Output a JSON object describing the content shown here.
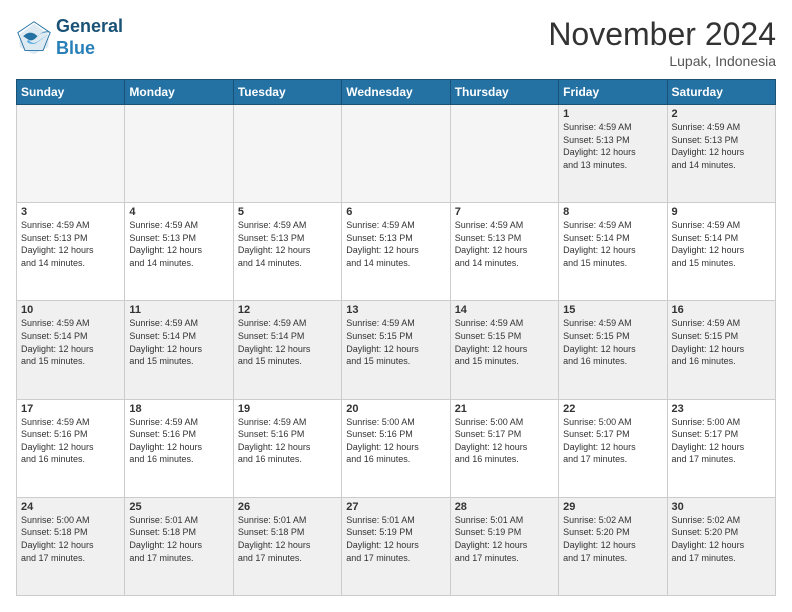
{
  "logo": {
    "line1": "General",
    "line2": "Blue"
  },
  "header": {
    "month": "November 2024",
    "location": "Lupak, Indonesia"
  },
  "weekdays": [
    "Sunday",
    "Monday",
    "Tuesday",
    "Wednesday",
    "Thursday",
    "Friday",
    "Saturday"
  ],
  "weeks": [
    [
      {
        "day": "",
        "info": "",
        "empty": true
      },
      {
        "day": "",
        "info": "",
        "empty": true
      },
      {
        "day": "",
        "info": "",
        "empty": true
      },
      {
        "day": "",
        "info": "",
        "empty": true
      },
      {
        "day": "",
        "info": "",
        "empty": true
      },
      {
        "day": "1",
        "info": "Sunrise: 4:59 AM\nSunset: 5:13 PM\nDaylight: 12 hours\nand 13 minutes.",
        "empty": false
      },
      {
        "day": "2",
        "info": "Sunrise: 4:59 AM\nSunset: 5:13 PM\nDaylight: 12 hours\nand 14 minutes.",
        "empty": false
      }
    ],
    [
      {
        "day": "3",
        "info": "Sunrise: 4:59 AM\nSunset: 5:13 PM\nDaylight: 12 hours\nand 14 minutes.",
        "empty": false
      },
      {
        "day": "4",
        "info": "Sunrise: 4:59 AM\nSunset: 5:13 PM\nDaylight: 12 hours\nand 14 minutes.",
        "empty": false
      },
      {
        "day": "5",
        "info": "Sunrise: 4:59 AM\nSunset: 5:13 PM\nDaylight: 12 hours\nand 14 minutes.",
        "empty": false
      },
      {
        "day": "6",
        "info": "Sunrise: 4:59 AM\nSunset: 5:13 PM\nDaylight: 12 hours\nand 14 minutes.",
        "empty": false
      },
      {
        "day": "7",
        "info": "Sunrise: 4:59 AM\nSunset: 5:13 PM\nDaylight: 12 hours\nand 14 minutes.",
        "empty": false
      },
      {
        "day": "8",
        "info": "Sunrise: 4:59 AM\nSunset: 5:14 PM\nDaylight: 12 hours\nand 15 minutes.",
        "empty": false
      },
      {
        "day": "9",
        "info": "Sunrise: 4:59 AM\nSunset: 5:14 PM\nDaylight: 12 hours\nand 15 minutes.",
        "empty": false
      }
    ],
    [
      {
        "day": "10",
        "info": "Sunrise: 4:59 AM\nSunset: 5:14 PM\nDaylight: 12 hours\nand 15 minutes.",
        "empty": false
      },
      {
        "day": "11",
        "info": "Sunrise: 4:59 AM\nSunset: 5:14 PM\nDaylight: 12 hours\nand 15 minutes.",
        "empty": false
      },
      {
        "day": "12",
        "info": "Sunrise: 4:59 AM\nSunset: 5:14 PM\nDaylight: 12 hours\nand 15 minutes.",
        "empty": false
      },
      {
        "day": "13",
        "info": "Sunrise: 4:59 AM\nSunset: 5:15 PM\nDaylight: 12 hours\nand 15 minutes.",
        "empty": false
      },
      {
        "day": "14",
        "info": "Sunrise: 4:59 AM\nSunset: 5:15 PM\nDaylight: 12 hours\nand 15 minutes.",
        "empty": false
      },
      {
        "day": "15",
        "info": "Sunrise: 4:59 AM\nSunset: 5:15 PM\nDaylight: 12 hours\nand 16 minutes.",
        "empty": false
      },
      {
        "day": "16",
        "info": "Sunrise: 4:59 AM\nSunset: 5:15 PM\nDaylight: 12 hours\nand 16 minutes.",
        "empty": false
      }
    ],
    [
      {
        "day": "17",
        "info": "Sunrise: 4:59 AM\nSunset: 5:16 PM\nDaylight: 12 hours\nand 16 minutes.",
        "empty": false
      },
      {
        "day": "18",
        "info": "Sunrise: 4:59 AM\nSunset: 5:16 PM\nDaylight: 12 hours\nand 16 minutes.",
        "empty": false
      },
      {
        "day": "19",
        "info": "Sunrise: 4:59 AM\nSunset: 5:16 PM\nDaylight: 12 hours\nand 16 minutes.",
        "empty": false
      },
      {
        "day": "20",
        "info": "Sunrise: 5:00 AM\nSunset: 5:16 PM\nDaylight: 12 hours\nand 16 minutes.",
        "empty": false
      },
      {
        "day": "21",
        "info": "Sunrise: 5:00 AM\nSunset: 5:17 PM\nDaylight: 12 hours\nand 16 minutes.",
        "empty": false
      },
      {
        "day": "22",
        "info": "Sunrise: 5:00 AM\nSunset: 5:17 PM\nDaylight: 12 hours\nand 17 minutes.",
        "empty": false
      },
      {
        "day": "23",
        "info": "Sunrise: 5:00 AM\nSunset: 5:17 PM\nDaylight: 12 hours\nand 17 minutes.",
        "empty": false
      }
    ],
    [
      {
        "day": "24",
        "info": "Sunrise: 5:00 AM\nSunset: 5:18 PM\nDaylight: 12 hours\nand 17 minutes.",
        "empty": false
      },
      {
        "day": "25",
        "info": "Sunrise: 5:01 AM\nSunset: 5:18 PM\nDaylight: 12 hours\nand 17 minutes.",
        "empty": false
      },
      {
        "day": "26",
        "info": "Sunrise: 5:01 AM\nSunset: 5:18 PM\nDaylight: 12 hours\nand 17 minutes.",
        "empty": false
      },
      {
        "day": "27",
        "info": "Sunrise: 5:01 AM\nSunset: 5:19 PM\nDaylight: 12 hours\nand 17 minutes.",
        "empty": false
      },
      {
        "day": "28",
        "info": "Sunrise: 5:01 AM\nSunset: 5:19 PM\nDaylight: 12 hours\nand 17 minutes.",
        "empty": false
      },
      {
        "day": "29",
        "info": "Sunrise: 5:02 AM\nSunset: 5:20 PM\nDaylight: 12 hours\nand 17 minutes.",
        "empty": false
      },
      {
        "day": "30",
        "info": "Sunrise: 5:02 AM\nSunset: 5:20 PM\nDaylight: 12 hours\nand 17 minutes.",
        "empty": false
      }
    ]
  ]
}
